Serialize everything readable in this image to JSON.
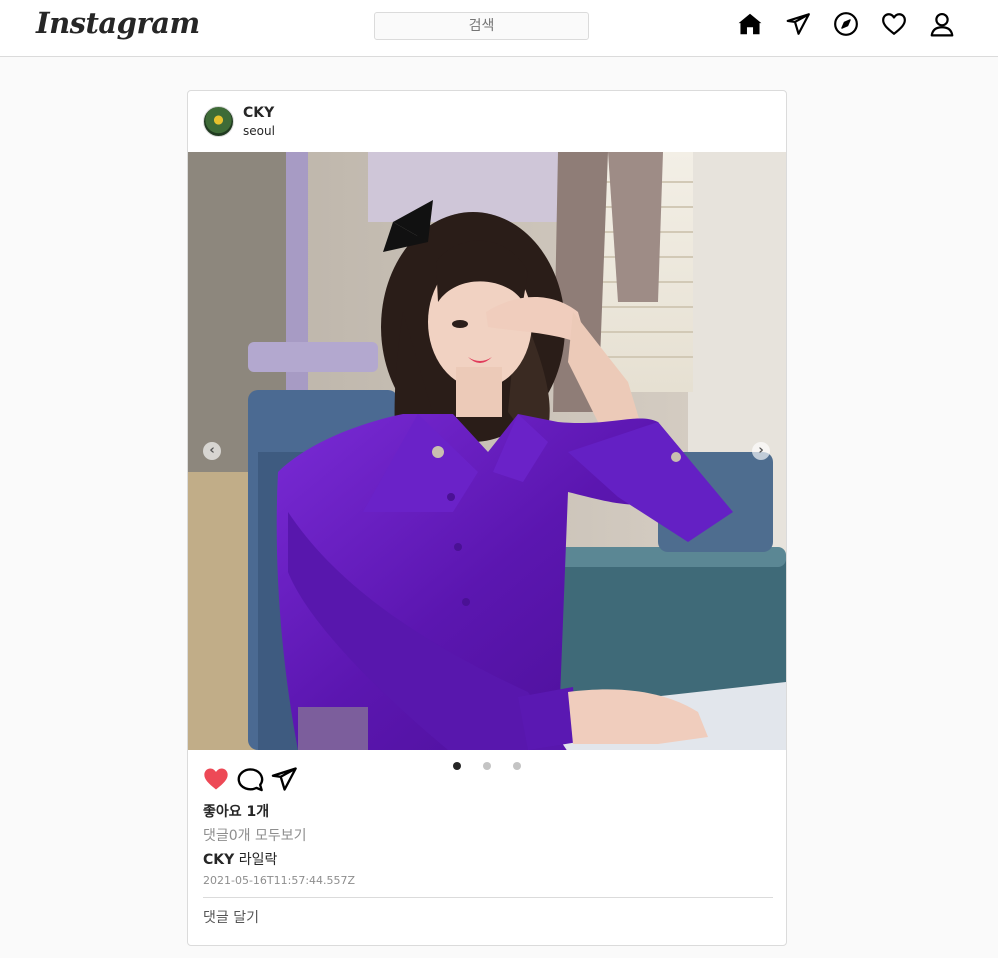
{
  "header": {
    "logo_text": "Instagram",
    "search_placeholder": "검색",
    "icons": [
      "home-icon",
      "direct-icon",
      "explore-icon",
      "activity-icon",
      "profile-icon"
    ]
  },
  "post": {
    "username": "CKY",
    "location": "seoul",
    "image": {
      "description": "woman in purple satin blouse posing in a vintage train carriage",
      "slide_count": 3,
      "active_slide": 1
    },
    "actions": {
      "liked": true,
      "like_color": "#ed4956",
      "icons": [
        "heart-icon",
        "comment-icon",
        "share-icon"
      ]
    },
    "likes_text": "좋아요 1개",
    "view_comments_text": "댓글0개 모두보기",
    "caption": {
      "username": "CKY",
      "text": "라일락"
    },
    "timestamp": "2021-05-16T11:57:44.557Z",
    "comment_placeholder": "댓글 달기"
  },
  "colors": {
    "text": "#262626",
    "muted": "#8e8e8e",
    "border": "#dbdbdb",
    "background": "#fafafa",
    "accent_like": "#ed4956"
  }
}
